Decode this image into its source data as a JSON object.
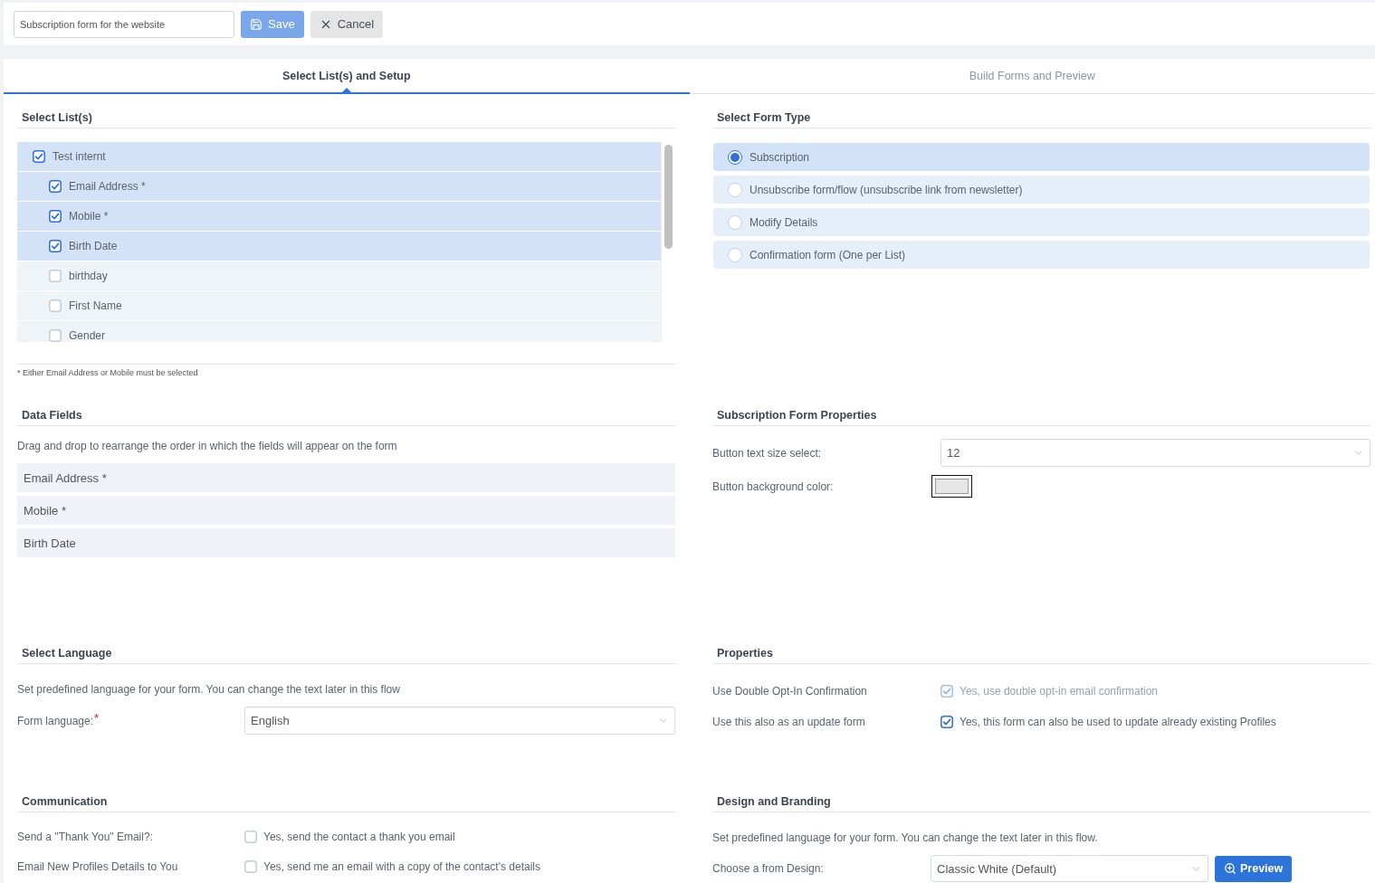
{
  "form_name": {
    "value": "Subscription form for the website"
  },
  "toolbar_buttons": [
    {
      "kind": "save",
      "label": "Save"
    },
    {
      "kind": "cancel",
      "label": "Cancel"
    }
  ],
  "tabs": [
    {
      "label": "Select List(s) and Setup",
      "selected": true
    },
    {
      "label": "Build Forms and Preview",
      "selected": false
    }
  ],
  "select_lists": {
    "title": "Select List(s)",
    "items": [
      {
        "label": "Test internt",
        "checked": true,
        "children": [
          {
            "label": "Email Address *",
            "checked": true
          },
          {
            "label": "Mobile *",
            "checked": true
          },
          {
            "label": "Birth Date",
            "checked": true
          },
          {
            "label": "birthday",
            "checked": false
          },
          {
            "label": "First Name",
            "checked": false
          },
          {
            "label": "Gender",
            "checked": false
          }
        ]
      }
    ],
    "footnote": "* Either Email Address or Mobile must be selected"
  },
  "form_type": {
    "title": "Select Form Type",
    "options": [
      {
        "label": "Subscription",
        "selected": true
      },
      {
        "label": "Unsubscribe form/flow (unsubscribe link from newsletter)",
        "selected": false
      },
      {
        "label": "Modify Details",
        "selected": false
      },
      {
        "label": "Confirmation form (One per List)",
        "selected": false
      }
    ]
  },
  "data_fields": {
    "title": "Data Fields",
    "hint": "Drag and drop to rearrange the order in which the fields will appear on the form",
    "fields": [
      "Email Address *",
      "Mobile *",
      "Birth Date"
    ]
  },
  "form_properties": {
    "title": "Subscription Form Properties",
    "rows": [
      {
        "kind": "select",
        "label": "Button text size select:",
        "value": "12"
      },
      {
        "kind": "color",
        "label": "Button background color:",
        "color": "#e6e6e6"
      }
    ]
  },
  "language": {
    "title": "Select Language",
    "description": "Set predefined language for your form. You can change the text later in this flow",
    "label": "Form language:",
    "required_mark": "*",
    "value": "English"
  },
  "properties": {
    "title": "Properties",
    "rows": [
      {
        "label": "Use Double Opt-In Confirmation",
        "option": "Yes, use double opt-in email confirmation",
        "checked": true,
        "disabled": true
      },
      {
        "label": "Use this also as an update form",
        "option": "Yes, this form can also be used to update already existing Profiles",
        "checked": true,
        "disabled": false
      }
    ]
  },
  "communication": {
    "title": "Communication",
    "rows": [
      {
        "label": "Send a \"Thank You\" Email?:",
        "option": "Yes, send the contact a thank you email",
        "checked": false
      },
      {
        "label": "Email New Profiles Details to You",
        "option": "Yes, send me an email with a copy of the contact's details",
        "checked": false
      }
    ]
  },
  "design": {
    "title": "Design and Branding",
    "description": "Set predefined language for your form. You can change the text later in this flow.",
    "label": "Choose a from Design:",
    "value": "Classic White (Default)",
    "button": "Preview"
  }
}
